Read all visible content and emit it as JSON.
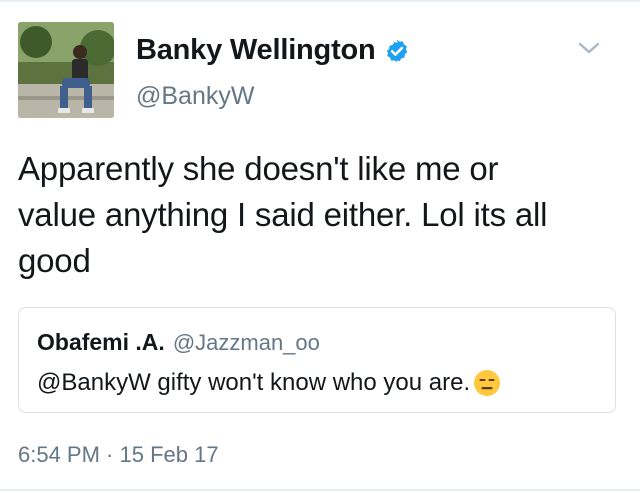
{
  "author": {
    "name": "Banky Wellington",
    "handle": "@BankyW",
    "verified": true
  },
  "tweet": {
    "line1": "Apparently she doesn't like me or",
    "line2": "value anything I said either. Lol its all",
    "line3": "good"
  },
  "quoted": {
    "name": "Obafemi .A.",
    "handle": "@Jazzman_oo",
    "text": "@BankyW gifty won't know who you are.",
    "emoji": "expressionless-face-emoji"
  },
  "timestamp": "6:54 PM · 15 Feb 17",
  "icons": {
    "verified": "verified-badge-icon",
    "menu": "chevron-down-icon"
  },
  "colors": {
    "primary_text": "#14171a",
    "secondary_text": "#657786",
    "verified_blue": "#1da1f2",
    "border": "#d9e1e6"
  }
}
